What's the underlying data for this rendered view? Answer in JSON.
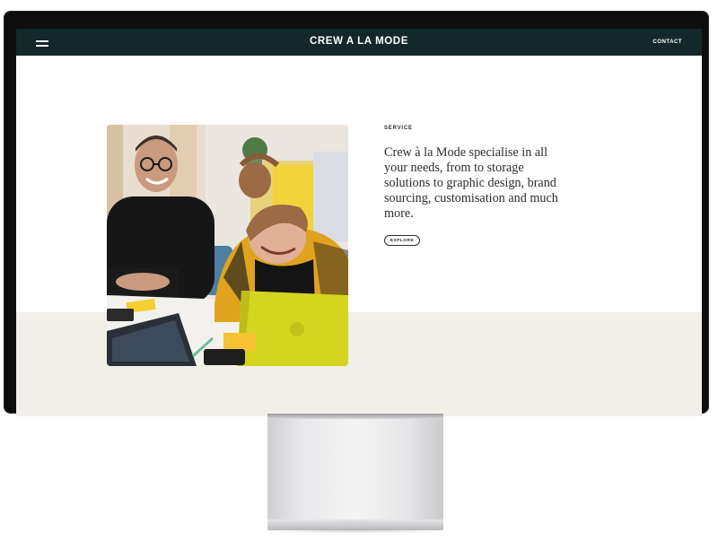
{
  "header": {
    "brand": "CREW A LA MODE",
    "contact_label": "CONTACT",
    "menu_icon": "hamburger-menu-icon"
  },
  "service": {
    "label": "SERVICE",
    "headline": "Crew à la Mode specialise in all your needs, from to storage solutions to graphic design, brand sourcing, customisation and much more.",
    "button_label": "EXPLORE"
  },
  "colors": {
    "topbar": "#13282a",
    "band": "#f2efe9",
    "text": "#2a2e2e"
  }
}
